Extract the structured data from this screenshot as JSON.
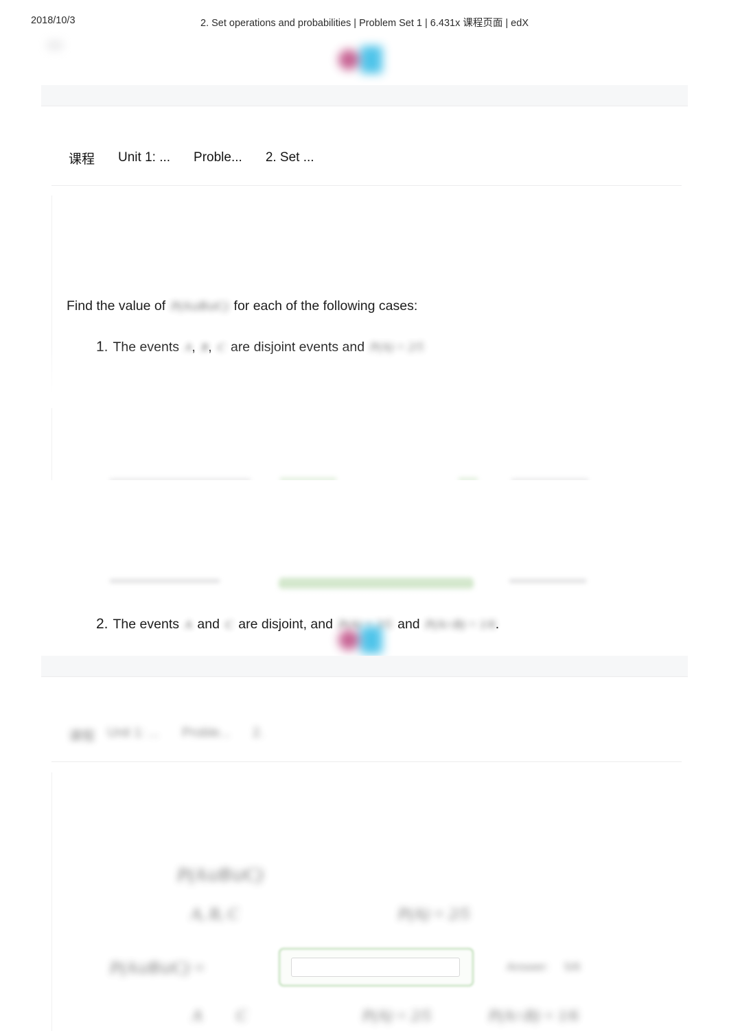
{
  "print_header": {
    "date": "2018/10/3",
    "title": "2. Set operations and probabilities | Problem Set 1 | 6.431x 课程页面 | edX"
  },
  "brand": {
    "logo_name": "edx-logo",
    "dot_color": "#c2558a",
    "square_color": "#41bfe8"
  },
  "breadcrumb": {
    "items": [
      {
        "label": "课程"
      },
      {
        "label": "Unit 1: ..."
      },
      {
        "label": "Proble..."
      },
      {
        "label": "2. Set ..."
      }
    ]
  },
  "problem": {
    "intro_before": "Find the value of",
    "intro_math": "P(A∪B∪C)",
    "intro_after": "for each of the following cases:",
    "items": [
      {
        "number": "1.",
        "text_before": "The events",
        "math_a": "A",
        "sep1": ",",
        "math_b": "B",
        "sep2": ",",
        "math_c": "C",
        "text_mid": "are disjoint events and",
        "math_tail": "P(A) = 2/5"
      },
      {
        "number": "2.",
        "text_before": "The events",
        "math_a": "A",
        "text_and1": "and",
        "math_b": "C",
        "text_mid": "are disjoint, and",
        "math_c": "P(A) = 2/5",
        "text_and2": "and",
        "math_d": "P(A∩B) = 1/6",
        "text_end": "."
      }
    ]
  },
  "answer_area": {
    "field_value": "",
    "field_placeholder": "",
    "border_color": "#b6d9ae",
    "label_left": "P(A∪B∪C) =",
    "label_right_1": "Answer:",
    "label_right_2": "5/6"
  },
  "lower_page": {
    "breadcrumb_blurred": [
      "课程",
      "Unit 1: ...",
      "Proble...",
      "2."
    ],
    "math_line_1": "P(A∪B∪C)",
    "math_line_2a": "A, B, C",
    "math_line_2b": "P(A) = 2/5",
    "math_line_3": "P(A∪B∪C) =",
    "math_line_4a": "A",
    "math_line_4b": "C",
    "math_line_4c": "P(A) = 2/5",
    "math_line_4d": "P(A∩B) = 1/6"
  },
  "colors": {
    "band": "#f6f7f8",
    "card": "#ffffff",
    "hairline": "#ececed",
    "green_accent": "#b6d9ae"
  }
}
